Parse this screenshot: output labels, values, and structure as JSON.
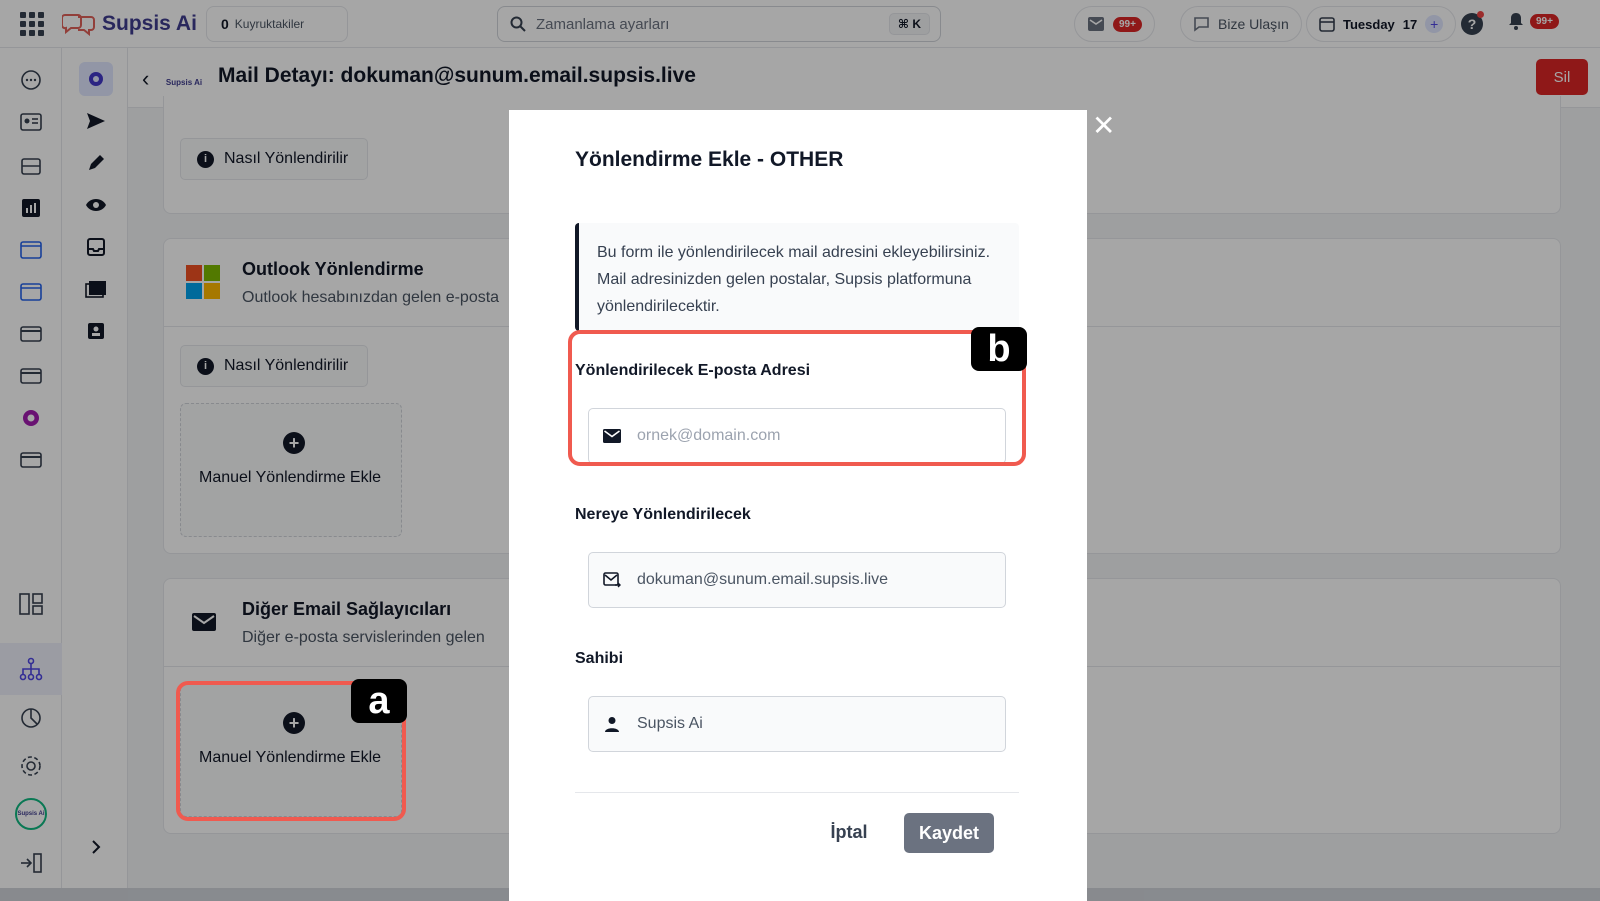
{
  "topbar": {
    "brand": "Supsis Ai",
    "queue_count": "0",
    "queue_label": "Kuyruktakiler",
    "search_placeholder": "Zamanlama ayarları",
    "search_shortcut": "⌘ K",
    "inbox_badge": "99+",
    "contact_label": "Bize Ulaşın",
    "date_weekday": "Tuesday",
    "date_day": "17",
    "notifications_badge": "99+"
  },
  "header": {
    "title": "Mail Detayı: dokuman@sunum.email.supsis.live",
    "delete_label": "Sil",
    "logo_text": "Supsis Ai"
  },
  "sections": {
    "first": {
      "how_label": "Nasıl Yönlendirilir"
    },
    "outlook": {
      "title": "Outlook Yönlendirme",
      "subtitle": "Outlook hesabınızdan gelen e-posta",
      "how_label": "Nasıl Yönlendirilir",
      "add_label": "Manuel Yönlendirme Ekle"
    },
    "other": {
      "title": "Diğer Email Sağlayıcıları",
      "subtitle": "Diğer e-posta servislerinden gelen",
      "add_label": "Manuel Yönlendirme Ekle"
    }
  },
  "modal": {
    "title": "Yönlendirme Ekle - OTHER",
    "notice": "Bu form ile yönlendirilecek mail adresini ekleyebilirsiniz. Mail adresinizden gelen postalar, Supsis platformuna yönlendirilecektir.",
    "email_label": "Yönlendirilecek E-posta Adresi",
    "email_placeholder": "ornek@domain.com",
    "target_label": "Nereye Yönlendirilecek",
    "target_value": "dokuman@sunum.email.supsis.live",
    "owner_label": "Sahibi",
    "owner_value": "Supsis Ai",
    "cancel_label": "İptal",
    "save_label": "Kaydet"
  },
  "annotations": {
    "a": "a",
    "b": "b"
  },
  "colors": {
    "brand": "#3f3d8f",
    "danger": "#dc2626",
    "highlight": "#f05a4f"
  },
  "icons": [
    "apps-grid-icon",
    "search-icon",
    "inbox-icon",
    "chat-icon",
    "calendar-icon",
    "help-icon",
    "bell-icon",
    "settings-icon",
    "send-icon",
    "eye-icon",
    "mail-icon",
    "person-icon",
    "close-icon"
  ]
}
